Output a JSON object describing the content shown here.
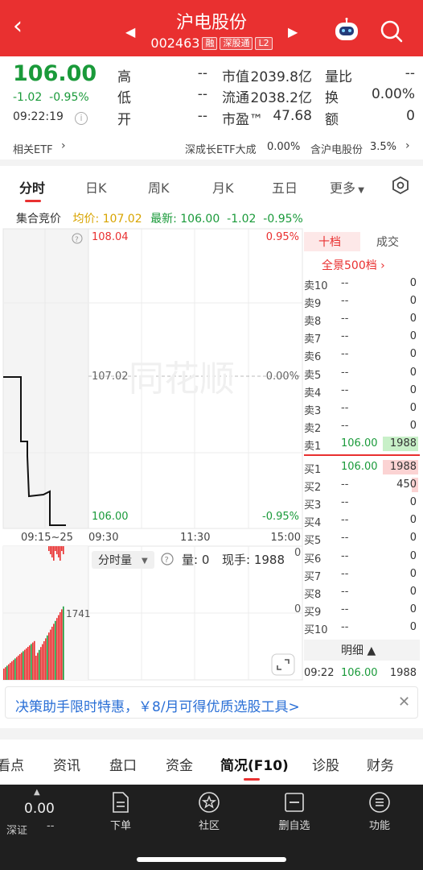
{
  "header": {
    "title": "沪电股份",
    "code": "002463",
    "tags": [
      "融",
      "深股通",
      "L2"
    ]
  },
  "quote": {
    "price": "106.00",
    "change": "-1.02",
    "change_pct": "-0.95%",
    "time": "09:22:19",
    "labels": {
      "high": "高",
      "low": "低",
      "open": "开",
      "mktcap": "市值",
      "float": "流通",
      "pe": "市盈™",
      "vol_ratio": "量比",
      "turnover": "换",
      "amount": "额"
    },
    "values": {
      "high": "--",
      "low": "--",
      "open": "--",
      "mktcap": "2039.8亿",
      "float": "2038.2亿",
      "pe": "47.68",
      "vol_ratio": "--",
      "turnover": "0.00%",
      "amount": "0"
    }
  },
  "etf": {
    "label": "相关ETF",
    "item1_name": "深成长ETF大成",
    "item1_value": "0.00%",
    "item2_name": "含沪电股份",
    "item2_value": "3.5%"
  },
  "tabs": [
    "分时",
    "日K",
    "周K",
    "月K",
    "五日",
    "更多"
  ],
  "legend": {
    "auction": "集合竞价",
    "avg_label": "均价:",
    "avg_value": "107.02",
    "latest_label": "最新:",
    "latest_value": "106.00",
    "chg": "-1.02",
    "chg_pct": "-0.95%"
  },
  "chart": {
    "top_price": "108.04",
    "top_pct": "0.95%",
    "mid_price": "107.02",
    "mid_pct": "0.00%",
    "bot_price": "106.00",
    "bot_pct": "-0.95%",
    "x_auction": "09:15~25",
    "x_labels": [
      "09:30",
      "11:30",
      "15:00"
    ],
    "watermark": "同花顺",
    "vol_value": "1741",
    "vol_selector": "分时量",
    "vol_label": "量:",
    "vol_amount": "0",
    "hand_label": "现手:",
    "hand_amount": "1988",
    "vol_zero": "0"
  },
  "orderbook": {
    "tab_active": "十档",
    "tab_other": "成交",
    "full_depth": "全景500档",
    "asks": [
      {
        "label": "卖10",
        "price": "--",
        "vol": "0"
      },
      {
        "label": "卖9",
        "price": "--",
        "vol": "0"
      },
      {
        "label": "卖8",
        "price": "--",
        "vol": "0"
      },
      {
        "label": "卖7",
        "price": "--",
        "vol": "0"
      },
      {
        "label": "卖6",
        "price": "--",
        "vol": "0"
      },
      {
        "label": "卖5",
        "price": "--",
        "vol": "0"
      },
      {
        "label": "卖4",
        "price": "--",
        "vol": "0"
      },
      {
        "label": "卖3",
        "price": "--",
        "vol": "0"
      },
      {
        "label": "卖2",
        "price": "--",
        "vol": "0"
      },
      {
        "label": "卖1",
        "price": "106.00",
        "vol": "1988"
      }
    ],
    "bids": [
      {
        "label": "买1",
        "price": "106.00",
        "vol": "1988"
      },
      {
        "label": "买2",
        "price": "--",
        "vol": "450"
      },
      {
        "label": "买3",
        "price": "--",
        "vol": "0"
      },
      {
        "label": "买4",
        "price": "--",
        "vol": "0"
      },
      {
        "label": "买5",
        "price": "--",
        "vol": "0"
      },
      {
        "label": "买6",
        "price": "--",
        "vol": "0"
      },
      {
        "label": "买7",
        "price": "--",
        "vol": "0"
      },
      {
        "label": "买8",
        "price": "--",
        "vol": "0"
      },
      {
        "label": "买9",
        "price": "--",
        "vol": "0"
      },
      {
        "label": "买10",
        "price": "--",
        "vol": "0"
      }
    ],
    "detail_label": "明细",
    "trade_time": "09:22",
    "trade_price": "106.00",
    "trade_vol": "1988"
  },
  "banner": {
    "text": "决策助手限时特惠，￥8/月可得优质选股工具>"
  },
  "bottom_tabs": [
    "看点",
    "资讯",
    "盘口",
    "资金",
    "简况(F10)",
    "诊股",
    "财务"
  ],
  "footer": {
    "index_value": "0.00",
    "index_name": "深证",
    "index_change": "--",
    "items": [
      "下单",
      "社区",
      "删自选",
      "功能"
    ]
  },
  "colors": {
    "brand": "#e93030",
    "down": "#1a9a3a",
    "up": "#e93030"
  }
}
